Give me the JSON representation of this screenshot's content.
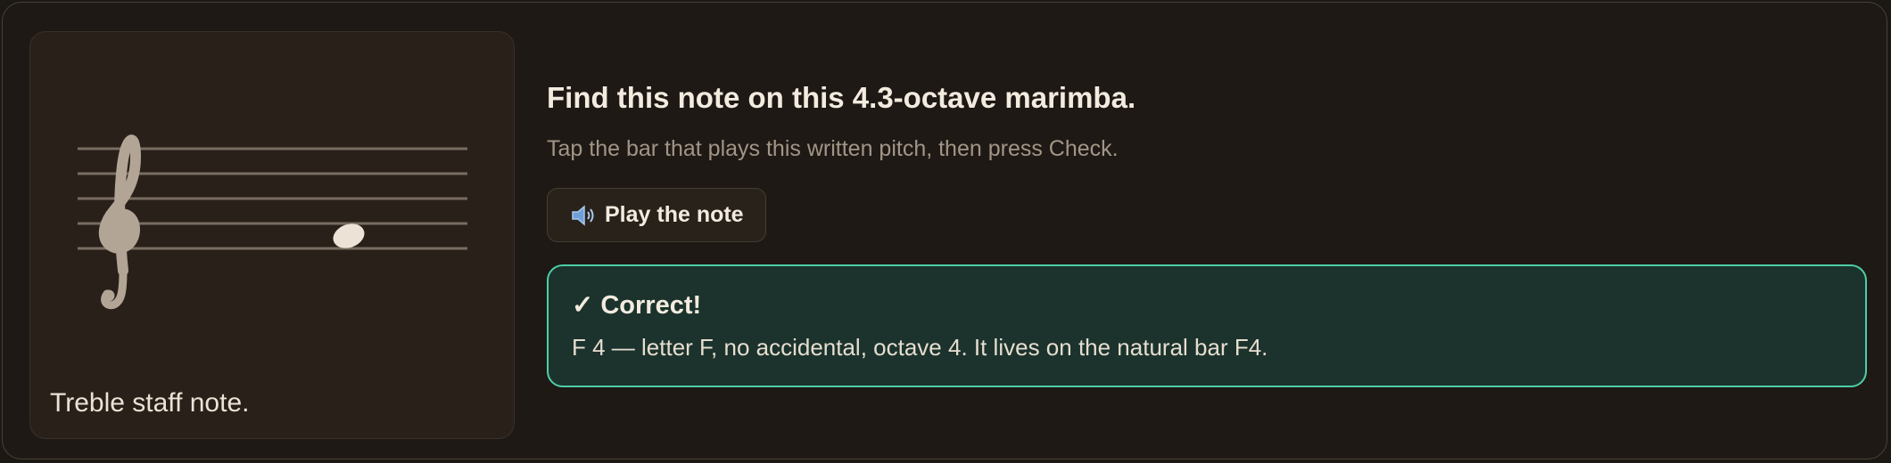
{
  "staff": {
    "clef": "treble",
    "note": "F4",
    "caption": "Treble staff note."
  },
  "question": {
    "title": "Find this note on this 4.3-octave marimba.",
    "instruction": "Tap the bar that plays this written pitch, then press Check."
  },
  "play_button": {
    "icon": "speaker-icon",
    "label": "Play the note"
  },
  "feedback": {
    "status": "correct",
    "title": "✓ Correct!",
    "message": "F 4 — letter F, no accidental, octave 4. It lives on the natural bar F4."
  },
  "colors": {
    "background": "#1c1814",
    "staff_lines": "#786d60",
    "clef": "#b3a595",
    "note": "#ece3d6",
    "feedback_border": "#4ecfa5",
    "feedback_bg": "#1b332c"
  }
}
